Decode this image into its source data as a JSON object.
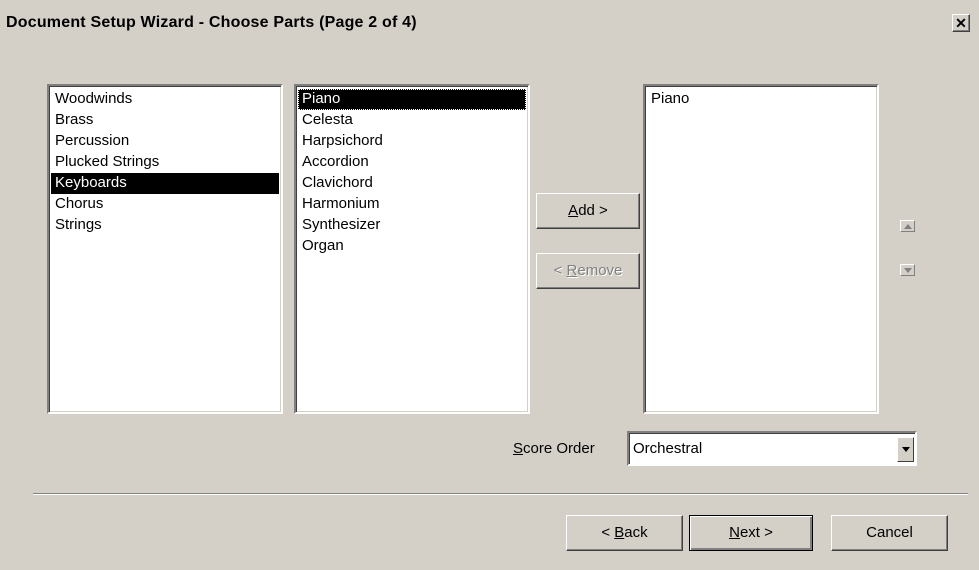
{
  "window": {
    "title": "Document Setup Wizard - Choose Parts (Page 2 of 4)",
    "close_glyph": "✕"
  },
  "families": [
    "Woodwinds",
    "Brass",
    "Percussion",
    "Plucked Strings",
    "Keyboards",
    "Chorus",
    "Strings"
  ],
  "families_selected": "Keyboards",
  "instruments": [
    "Piano",
    "Celesta",
    "Harpsichord",
    "Accordion",
    "Clavichord",
    "Harmonium",
    "Synthesizer",
    "Organ"
  ],
  "instruments_selected": "Piano",
  "buttons": {
    "add_mnemonic": "A",
    "add_rest": "dd >",
    "remove_prefix": "< ",
    "remove_mnemonic": "R",
    "remove_rest": "emove",
    "back_prefix": "< ",
    "back_mnemonic": "B",
    "back_rest": "ack",
    "next_mnemonic": "N",
    "next_rest": "ext >",
    "cancel": "Cancel"
  },
  "selected_parts": [
    "Piano"
  ],
  "score_order": {
    "label_mnemonic": "S",
    "label_rest": "core Order",
    "value": "Orchestral"
  },
  "icons": {
    "move_up": "triangle-up-icon",
    "move_down": "triangle-down-icon",
    "dropdown": "chevron-down-icon"
  }
}
